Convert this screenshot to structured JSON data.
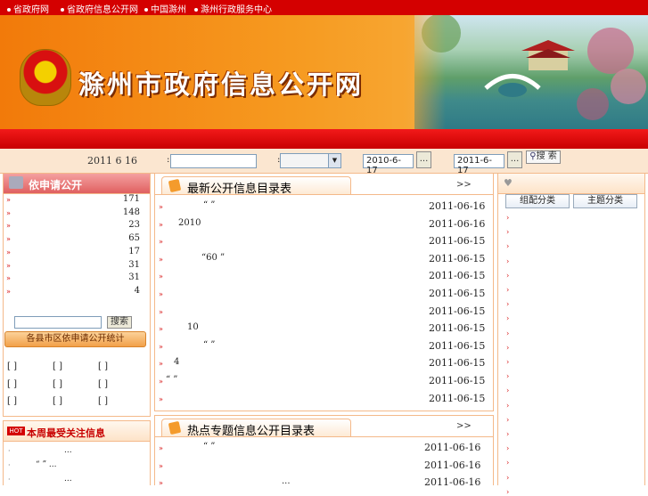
{
  "top_links": [
    "省政府网",
    "省政府信息公开网",
    "中国滁州",
    "滁州行政服务中心"
  ],
  "banner": {
    "title": "滁州市政府信息公开网"
  },
  "search": {
    "date": "2011  6  16",
    "keyword_value": "",
    "from_date": "2010-6-17",
    "to_date": "2011-6-17",
    "browse_label": "...",
    "submit_label": "搜 索",
    "sep1": ":",
    "sep2": ":"
  },
  "left": {
    "title": "依申请公开",
    "stats": [
      "171",
      "148",
      "23",
      "65",
      "17",
      "31",
      "31",
      "4"
    ],
    "search_label": "搜索",
    "stats_button": "各县市区依申请公开统计",
    "brackets": [
      [
        "[    ]",
        "[    ]",
        "[    ]"
      ],
      [
        "[    ]",
        "[    ]",
        "[    ]"
      ],
      [
        "[    ]",
        "[    ]",
        "[    ]"
      ]
    ],
    "hot_badge": "HOT",
    "hot_title": "本周最受关注信息",
    "hot_items": [
      "...",
      "“    ”  ...",
      "..."
    ]
  },
  "center": {
    "section1": {
      "title": "最新公开信息目录表",
      "more": ">>",
      "rows": [
        {
          "text": "“    ”",
          "date": "2011-06-16"
        },
        {
          "text": "2010",
          "date": "2011-06-16"
        },
        {
          "text": "",
          "date": "2011-06-15"
        },
        {
          "text": "“60        ”",
          "date": "2011-06-15"
        },
        {
          "text": "",
          "date": "2011-06-15"
        },
        {
          "text": "",
          "date": "2011-06-15"
        },
        {
          "text": "",
          "date": "2011-06-15"
        },
        {
          "text": "10",
          "date": "2011-06-15"
        },
        {
          "text": "“    ”",
          "date": "2011-06-15"
        },
        {
          "text": "4",
          "date": "2011-06-15"
        },
        {
          "text": "“    ”",
          "date": "2011-06-15"
        },
        {
          "text": "",
          "date": "2011-06-15"
        }
      ]
    },
    "section2": {
      "title": "热点专题信息公开目录表",
      "more": ">>",
      "rows": [
        {
          "text": "“   ”",
          "date": "2011-06-16"
        },
        {
          "text": "",
          "date": "2011-06-16"
        },
        {
          "text": "...",
          "date": "2011-06-16"
        }
      ]
    }
  },
  "right": {
    "btn_org": "组配分类",
    "btn_topic": "主题分类",
    "bullet_count": 20
  },
  "colors": {
    "accent_red": "#d40000",
    "orange": "#f49b2c",
    "panel_border": "#f4b98a"
  }
}
